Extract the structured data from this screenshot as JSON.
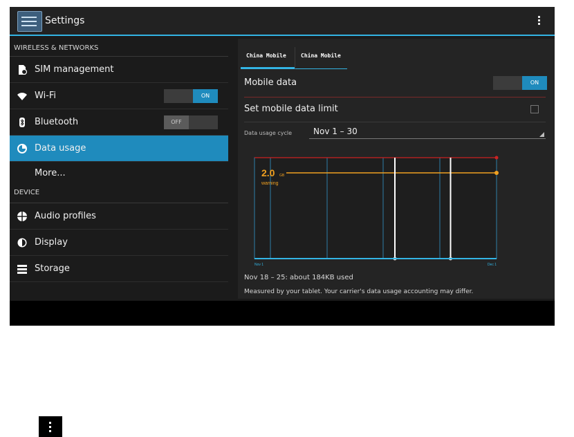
{
  "actionbar": {
    "title": "Settings",
    "app_icon": "settings-icon",
    "overflow_icon": "overflow-menu-icon"
  },
  "sidebar": {
    "section_wireless": "WIRELESS & NETWORKS",
    "section_device": "DEVICE",
    "items": [
      {
        "label": "SIM management",
        "icon": "sim-icon"
      },
      {
        "label": "Wi-Fi",
        "icon": "wifi-icon",
        "toggle": "ON"
      },
      {
        "label": "Bluetooth",
        "icon": "bluetooth-icon",
        "toggle": "OFF"
      },
      {
        "label": "Data usage",
        "icon": "data-usage-icon",
        "selected": true
      },
      {
        "label": "More..."
      },
      {
        "label": "Audio profiles",
        "icon": "audio-profiles-icon"
      },
      {
        "label": "Display",
        "icon": "display-icon"
      },
      {
        "label": "Storage",
        "icon": "storage-icon"
      }
    ]
  },
  "data_usage": {
    "tabs": [
      "China Mobile",
      "China Mobile"
    ],
    "mobile_data_label": "Mobile data",
    "mobile_data_toggle": "ON",
    "limit_label": "Set mobile data limit",
    "cycle_label": "Data usage cycle",
    "cycle_value": "Nov 1 – 30",
    "summary": "Nov 18 – 25: about 184KB used",
    "disclaimer": "Measured by your tablet. Your carrier's data usage accounting may differ."
  },
  "chart_data": {
    "type": "area",
    "x_start_label": "Nov 1",
    "x_end_label": "Dec 1",
    "warning_value": "2.0",
    "warning_unit": "GB",
    "warning_label": "warning",
    "range_start_fraction": 0.58,
    "range_end_fraction": 0.81
  },
  "colors": {
    "accent": "#33b5e5",
    "selected_bg": "#1f8bbd",
    "limit_line": "#cc2222",
    "warning_line": "#f0a020"
  }
}
